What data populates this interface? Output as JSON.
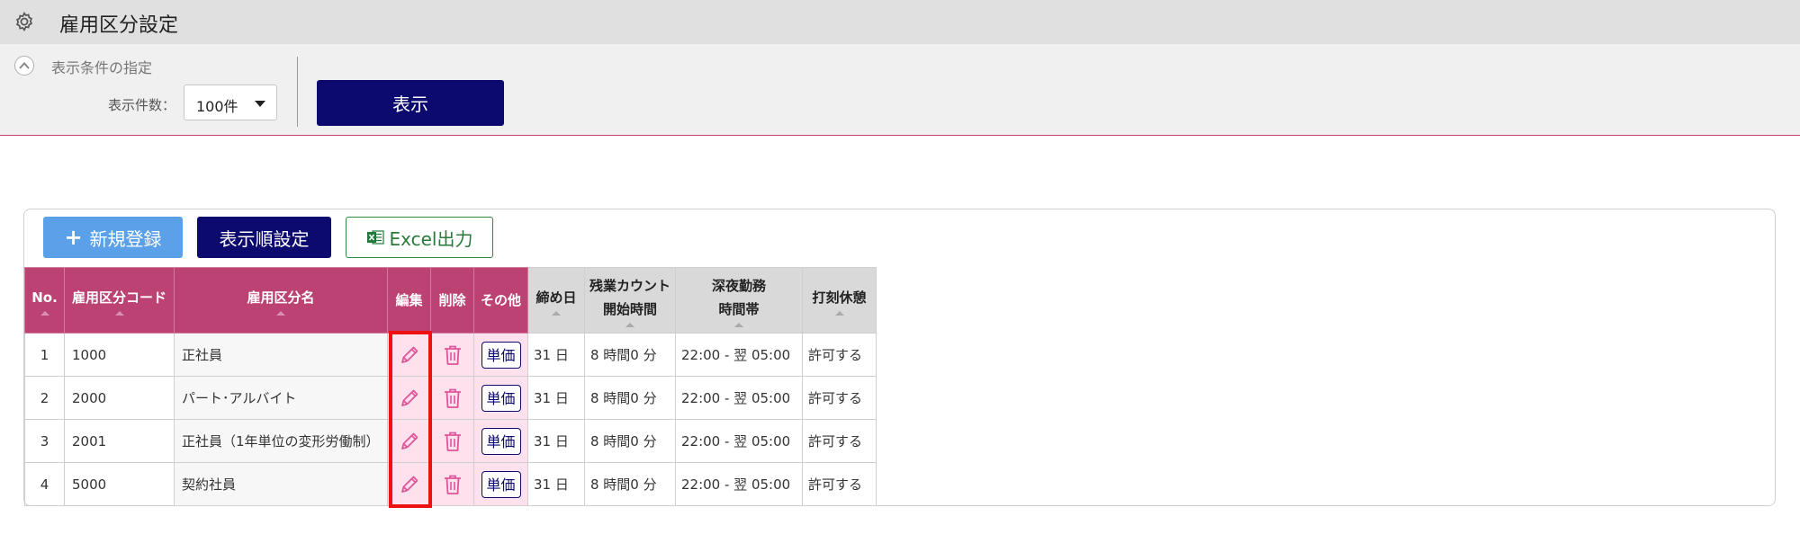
{
  "header": {
    "title": "雇用区分設定",
    "icon": "gear-icon"
  },
  "conditions": {
    "section_label": "表示条件の指定",
    "count_label": "表示件数：",
    "count_value": "100件",
    "show_button": "表示"
  },
  "toolbar": {
    "new_label": "新規登録",
    "new_icon": "+",
    "order_label": "表示順設定",
    "excel_label": "Excel出力"
  },
  "table": {
    "headers": {
      "no": "No.",
      "code": "雇用区分コード",
      "name": "雇用区分名",
      "edit": "編集",
      "delete": "削除",
      "other": "その他",
      "closing": "締め日",
      "overtime_1": "残業カウント",
      "overtime_2": "開始時間",
      "night_1": "深夜勤務",
      "night_2": "時間帯",
      "break": "打刻休憩"
    },
    "price_label": "単価",
    "rows": [
      {
        "no": "1",
        "code": "1000",
        "name": "正社員",
        "closing": "31 日",
        "overtime": "8 時間0 分",
        "night": "22:00 - 翌 05:00",
        "break": "許可する"
      },
      {
        "no": "2",
        "code": "2000",
        "name": "パート･アルバイト",
        "closing": "31 日",
        "overtime": "8 時間0 分",
        "night": "22:00 - 翌 05:00",
        "break": "許可する"
      },
      {
        "no": "3",
        "code": "2001",
        "name": "正社員（1年単位の変形労働制）",
        "closing": "31 日",
        "overtime": "8 時間0 分",
        "night": "22:00 - 翌 05:00",
        "break": "許可する"
      },
      {
        "no": "4",
        "code": "5000",
        "name": "契約社員",
        "closing": "31 日",
        "overtime": "8 時間0 分",
        "night": "22:00 - 翌 05:00",
        "break": "許可する"
      }
    ]
  },
  "colors": {
    "header_pink": "#bb4273",
    "action_cell_pink": "#fde1ec",
    "primary_navy": "#0c0a6e",
    "new_button_blue": "#5aa1ea",
    "excel_green": "#2e8b44",
    "highlight_red": "#ee1111"
  }
}
